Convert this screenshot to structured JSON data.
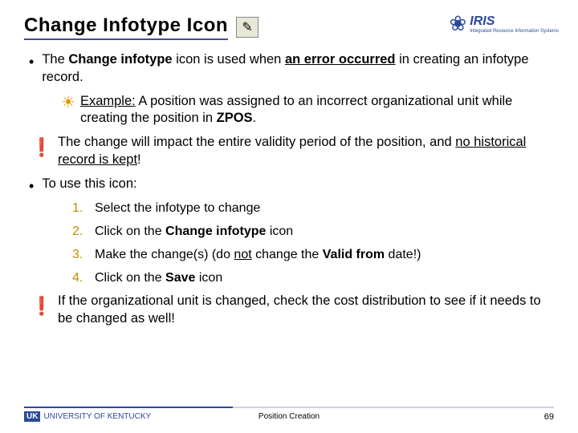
{
  "title": "Change Infotype Icon",
  "iris": {
    "label": "IRIS",
    "sub": "Integrated Resource\nInformation Systems"
  },
  "bullets": {
    "b1_pre": "The ",
    "b1_bold": "Change infotype",
    "b1_mid": " icon is used when ",
    "b1_uline": "an error occurred",
    "b1_post": " in creating an infotype record.",
    "example_label": "Example:",
    "example_text": "  A position was assigned to an incorrect organizational unit while creating the position in ",
    "example_bold": "ZPOS",
    "example_end": ".",
    "warn1_a": "The change will impact the entire validity period of the position, and ",
    "warn1_u": "no historical record is kept",
    "warn1_b": "!",
    "b2": "To use this icon:",
    "steps": {
      "s1": "Select the infotype to change",
      "s2_a": "Click on the ",
      "s2_b": "Change infotype",
      "s2_c": " icon",
      "s3_a": "Make the change(s) (do ",
      "s3_u": "not",
      "s3_b": " change the ",
      "s3_bold": "Valid from",
      "s3_c": " date!)",
      "s4_a": "Click on the ",
      "s4_b": "Save",
      "s4_c": " icon"
    },
    "warn2": "If the organizational unit is changed, check the cost distribution to see if it needs to be changed as well!"
  },
  "footer": {
    "uk": "UNIVERSITY OF KENTUCKY",
    "center": "Position Creation",
    "page": "69"
  }
}
